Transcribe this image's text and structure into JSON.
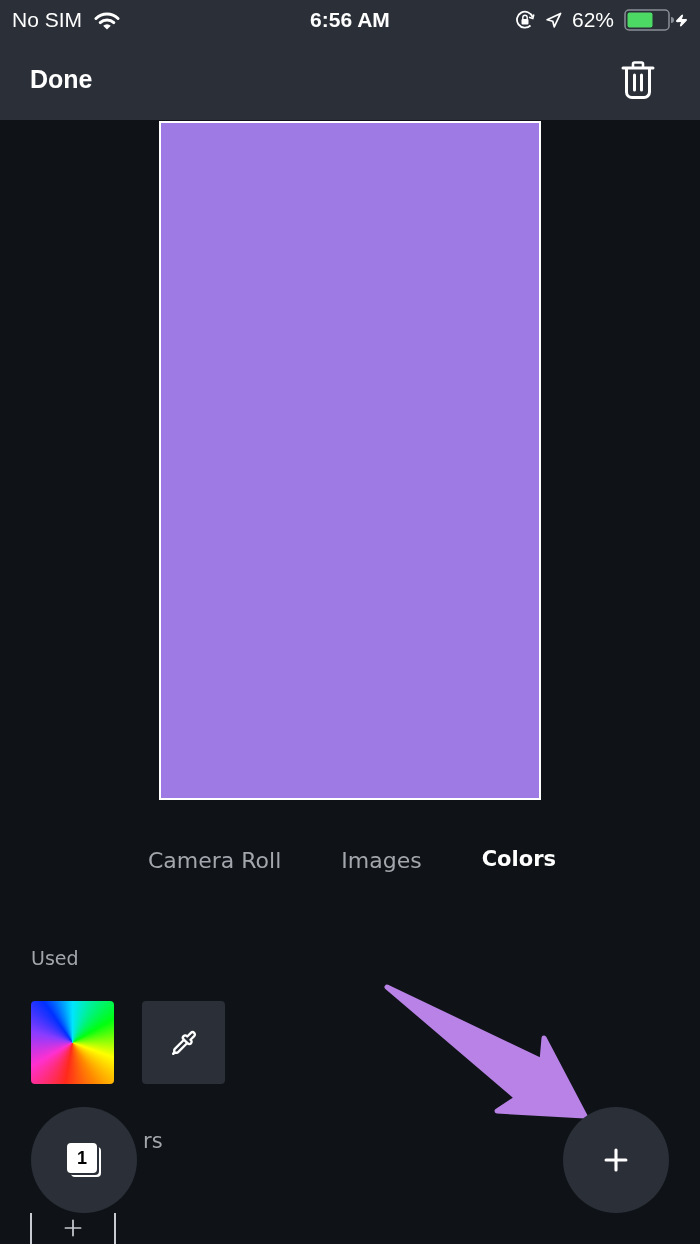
{
  "status_bar": {
    "carrier": "No SIM",
    "time": "6:56 AM",
    "battery_percent": "62%"
  },
  "nav_bar": {
    "done_label": "Done"
  },
  "tabs": [
    {
      "label": "Camera Roll",
      "selected": false
    },
    {
      "label": "Images",
      "selected": false
    },
    {
      "label": "Colors",
      "selected": true
    }
  ],
  "used_section": {
    "title": "Used",
    "swatches": [
      {
        "kind": "color_wheel"
      },
      {
        "kind": "eyedropper"
      }
    ]
  },
  "next_section": {
    "title": "rs"
  },
  "pages_button": {
    "count": "1"
  }
}
